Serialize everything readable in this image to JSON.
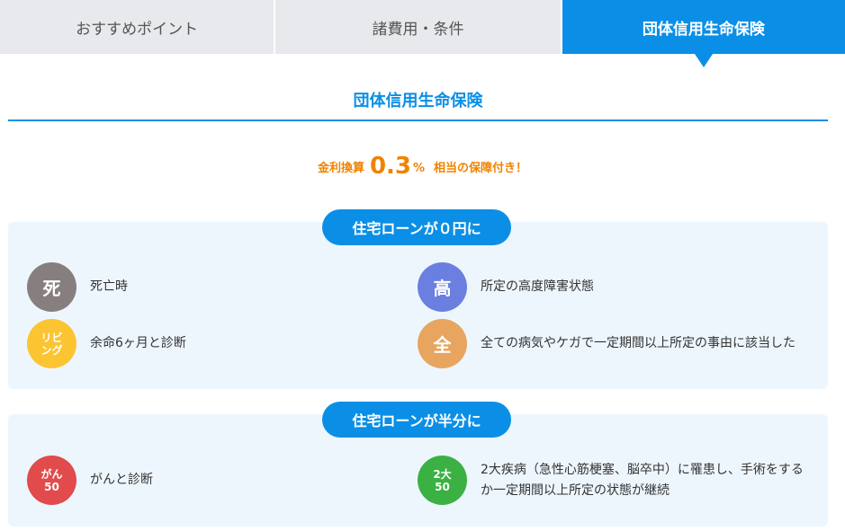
{
  "tabs": [
    {
      "label": "おすすめポイント",
      "active": false
    },
    {
      "label": "諸費用・条件",
      "active": false
    },
    {
      "label": "団体信用生命保険",
      "active": true
    }
  ],
  "section_title": "団体信用生命保険",
  "rate": {
    "prefix": "金利換算",
    "value": "0.3",
    "unit": "%",
    "suffix": "相当の保障付き！"
  },
  "groups": [
    {
      "heading": "住宅ローンが０円に",
      "items": [
        {
          "badge": "死",
          "text": "死亡時",
          "color": "#877f7f"
        },
        {
          "badge": "高",
          "text": "所定の高度障害状態",
          "color": "#6a7fe0"
        },
        {
          "badge": "リビ\nング",
          "text": "余命6ヶ月と診断",
          "color": "#fbc531"
        },
        {
          "badge": "全",
          "text": "全ての病気やケガで一定期間以上所定の事由に該当した",
          "color": "#e8a55f"
        }
      ]
    },
    {
      "heading": "住宅ローンが半分に",
      "items": [
        {
          "badge": "がん\n50",
          "text": "がんと診断",
          "color": "#e24b4b"
        },
        {
          "badge": "2大\n50",
          "text": "2大疾病（急性心筋梗塞、脳卒中）に罹患し、手術をするか一定期間以上所定の状態が継続",
          "color": "#3bb144"
        }
      ]
    }
  ]
}
